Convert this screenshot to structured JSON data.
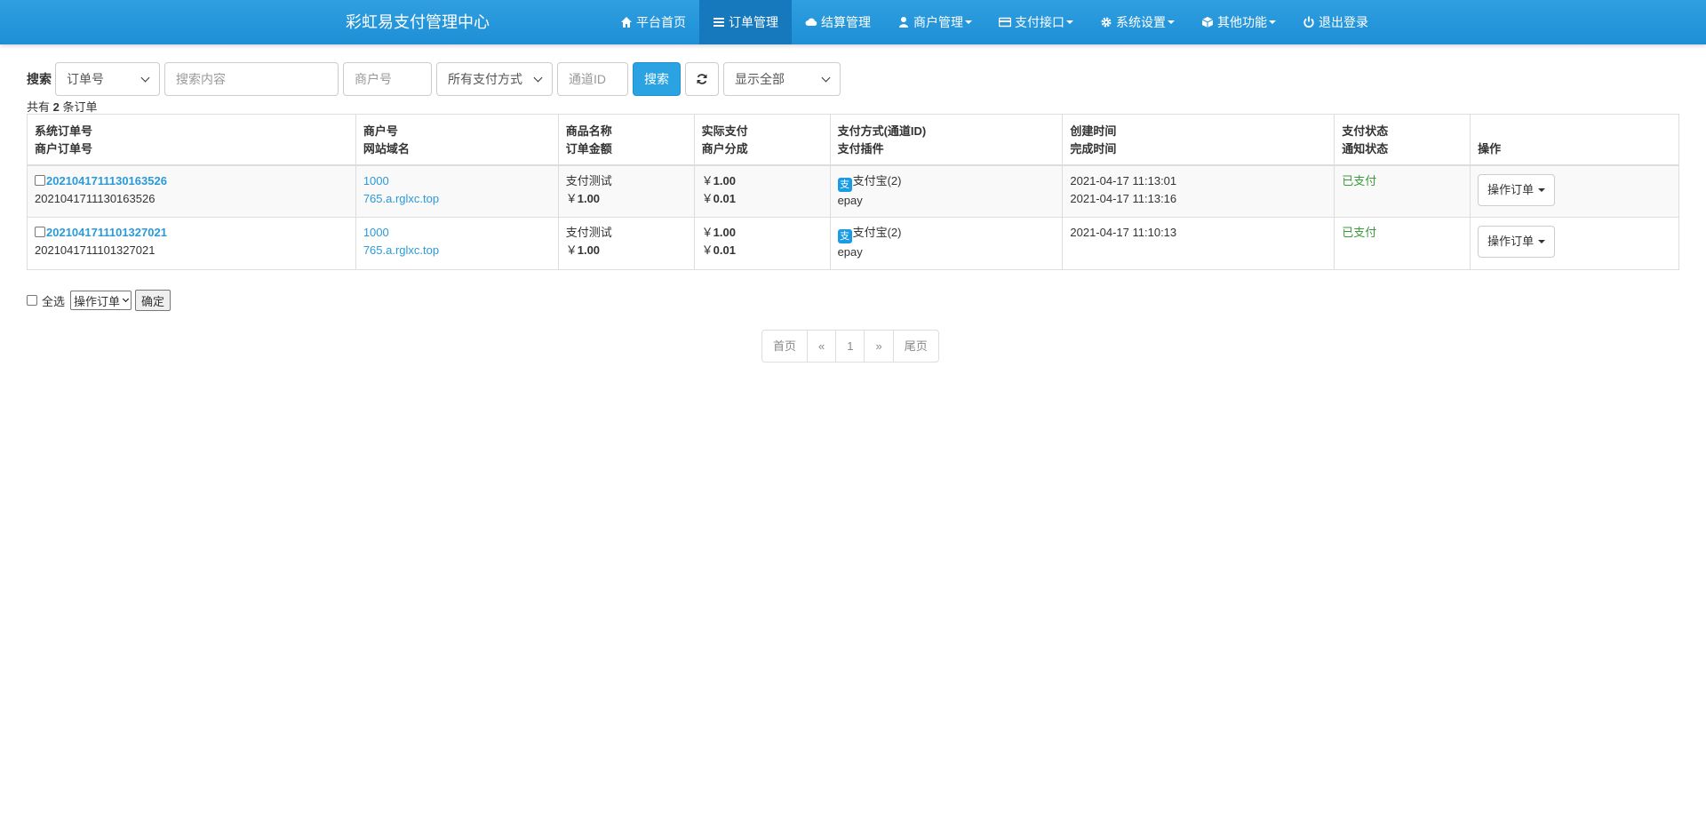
{
  "app": {
    "title": "彩虹易支付管理中心"
  },
  "nav": {
    "items": [
      {
        "label": "平台首页",
        "icon": "home-icon"
      },
      {
        "label": "订单管理",
        "icon": "list-icon"
      },
      {
        "label": "结算管理",
        "icon": "cloud-icon"
      },
      {
        "label": "商户管理",
        "icon": "user-icon"
      },
      {
        "label": "支付接口",
        "icon": "credit-card-icon"
      },
      {
        "label": "系统设置",
        "icon": "gear-icon"
      },
      {
        "label": "其他功能",
        "icon": "cube-icon"
      },
      {
        "label": "退出登录",
        "icon": "power-icon"
      }
    ],
    "active": "订单管理",
    "accent": "#2f9fe0"
  },
  "search": {
    "label": "搜索",
    "type_select": "订单号",
    "content_placeholder": "搜索内容",
    "merchant_placeholder": "商户号",
    "pay_type_select": "所有支付方式",
    "channel_placeholder": "通道ID",
    "search_button": "搜索",
    "status_select": "显示全部"
  },
  "summary": {
    "prefix": "共有",
    "count": "2",
    "suffix": "条订单"
  },
  "table": {
    "headers": [
      [
        "系统订单号",
        "商户订单号"
      ],
      [
        "商户号",
        "网站域名"
      ],
      [
        "商品名称",
        "订单金额"
      ],
      [
        "实际支付",
        "商户分成"
      ],
      [
        "支付方式(通道ID)",
        "支付插件"
      ],
      [
        "创建时间",
        "完成时间"
      ],
      [
        "支付状态",
        "通知状态"
      ],
      [
        "",
        "操作"
      ]
    ],
    "rows": [
      {
        "trade_no": "2021041711130163526",
        "out_trade_no": "2021041711130163526",
        "merchant_id": "1000",
        "domain": "765.a.rglxc.top",
        "product": "支付测试",
        "money": "1.00",
        "real_money": "1.00",
        "merchant_share": "0.01",
        "pay_type": "支付宝(2)",
        "plugin": "epay",
        "create_time": "2021-04-17 11:13:01",
        "end_time": "2021-04-17 11:13:16",
        "status": "已支付",
        "notify_status": "",
        "action": "操作订单"
      },
      {
        "trade_no": "2021041711101327021",
        "out_trade_no": "2021041711101327021",
        "merchant_id": "1000",
        "domain": "765.a.rglxc.top",
        "product": "支付测试",
        "money": "1.00",
        "real_money": "1.00",
        "merchant_share": "0.01",
        "pay_type": "支付宝(2)",
        "plugin": "epay",
        "create_time": "2021-04-17 11:10:13",
        "end_time": "",
        "status": "已支付",
        "notify_status": "",
        "action": "操作订单"
      }
    ],
    "currency": "￥",
    "alipay_glyph": "支",
    "status_color": "#3c9a3c"
  },
  "bulk": {
    "select_all": "全选",
    "action_select": "操作订单",
    "confirm": "确定"
  },
  "pagination": {
    "first": "首页",
    "prev": "«",
    "current": "1",
    "next": "»",
    "last": "尾页"
  }
}
